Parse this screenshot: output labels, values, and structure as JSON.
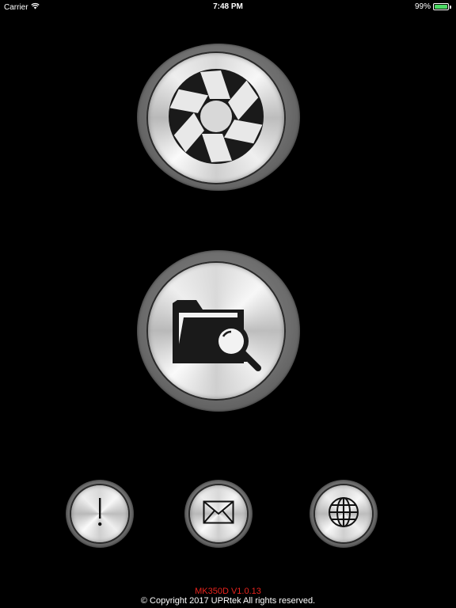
{
  "status_bar": {
    "carrier": "Carrier",
    "time": "7:48 PM",
    "battery_percent": "99%",
    "battery_level": 0.99,
    "battery_color": "#4cd964",
    "wifi_icon": "wifi-icon",
    "battery_icon": "battery-icon"
  },
  "buttons": {
    "camera": {
      "icon": "camera-shutter-icon"
    },
    "folder": {
      "icon": "folder-search-icon"
    },
    "info": {
      "icon": "exclamation-icon"
    },
    "mail": {
      "icon": "envelope-icon"
    },
    "web": {
      "icon": "globe-icon"
    }
  },
  "footer": {
    "version": "MK350D V1.0.13",
    "copyright": "© Copyright 2017 UPRtek All rights reserved.",
    "version_color": "#e8231d"
  }
}
